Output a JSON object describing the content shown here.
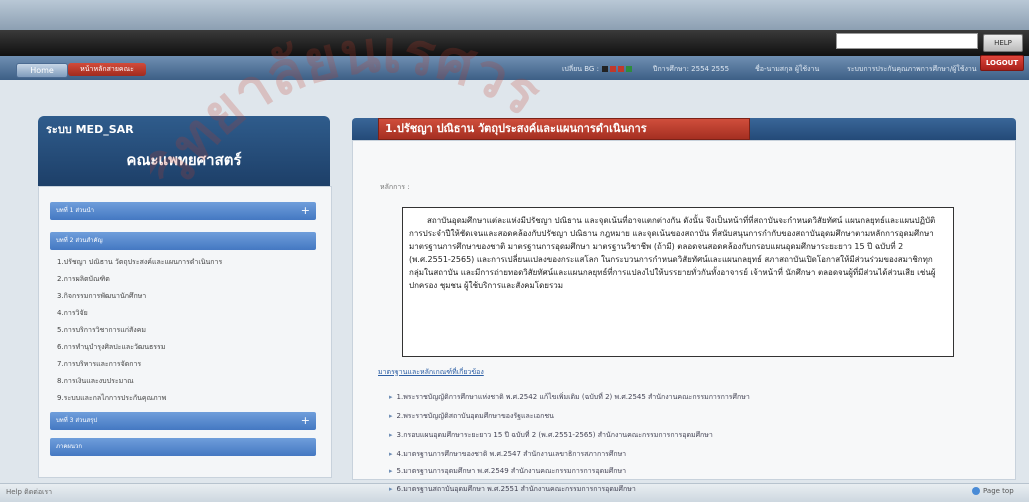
{
  "header": {
    "help_label": "HELP",
    "logout_label": "LOGOUT"
  },
  "nav": {
    "home": "Home",
    "crumb": "หน้าหลักสายคณะ",
    "bg_label": "เปลี่ยน BG :",
    "bg_colors": [
      "#222222",
      "#c0392b",
      "#c0392b",
      "#2e8b3e"
    ],
    "year_text": "ปีการศึกษา: 2554 2555",
    "user_text": "ชื่อ-นามสกุล ผู้ใช้งาน",
    "role_text": "ระบบการประกันคุณภาพการศึกษา/ผู้ใช้งาน"
  },
  "left": {
    "system_title": "ระบบ MED_SAR",
    "faculty": "คณะแพทยศาสตร์",
    "acc1": "บทที่ 1 ส่วนนำ",
    "acc2": "บทที่ 2 ส่วนสำคัญ",
    "items": [
      "1.ปรัชญา ปณิธาน วัตถุประสงค์และแผนการดำเนินการ",
      "2.การผลิตบัณฑิต",
      "3.กิจกรรมการพัฒนานักศึกษา",
      "4.การวิจัย",
      "5.การบริการวิชาการแก่สังคม",
      "6.การทำนุบำรุงศิลปะและวัฒนธรรม",
      "7.การบริหารและการจัดการ",
      "8.การเงินและงบประมาณ",
      "9.ระบบและกลไกการประกันคุณภาพ"
    ],
    "acc3": "บทที่ 3 ส่วนสรุป",
    "acc4": "ภาคผนวก"
  },
  "right": {
    "tab_title": "1.ปรัชญา ปณิธาน วัตถุประสงค์และแผนการดำเนินการ",
    "section_label": "หลักการ :",
    "vision_text": "สถาบันอุดมศึกษาแต่ละแห่งมีปรัชญา ปณิธาน และจุดเน้นที่อาจแตกต่างกัน ดังนั้น จึงเป็นหน้าที่ที่สถาบันจะกำหนดวิสัยทัศน์ แผนกลยุทธ์และแผนปฏิบัติการประจำปีให้ชัดเจนและสอดคล้องกับปรัชญา ปณิธาน กฎหมาย และจุดเน้นของสถาบัน ที่สนับสนุนการกำกับของสถาบันอุดมศึกษาตามหลักการอุดมศึกษา มาตรฐานการศึกษาของชาติ มาตรฐานการอุดมศึกษา มาตรฐานวิชาชีพ (ถ้ามี) ตลอดจนสอดคล้องกับกรอบแผนอุดมศึกษาระยะยาว 15 ปี ฉบับที่ 2 (พ.ศ.2551-2565) และการเปลี่ยนแปลงของกระแสโลก ในกระบวนการกำหนดวิสัยทัศน์และแผนกลยุทธ์ สภาสถาบันเปิดโอกาสให้มีส่วนร่วมของสมาชิกทุกกลุ่มในสถาบัน และมีการถ่ายทอดวิสัยทัศน์และแผนกลยุทธ์ที่การแปลงไปให้บรรยายทั่วกันทั้งอาจารย์ เจ้าหน้าที่ นักศึกษา ตลอดจนผู้ที่มีส่วนได้ส่วนเสีย เช่นผู้ปกครอง ชุมชน ผู้ใช้บริการและสังคมโดยรวม",
    "ref_head": "มาตรฐานและหลักเกณฑ์ที่เกี่ยวข้อง",
    "refs": [
      "1.พระราชบัญญัติการศึกษาแห่งชาติ พ.ศ.2542 แก้ไขเพิ่มเติม (ฉบับที่ 2) พ.ศ.2545 สำนักงานคณะกรรมการการศึกษา",
      "2.พระราชบัญญัติสถาบันอุดมศึกษาของรัฐและเอกชน",
      "3.กรอบแผนอุดมศึกษาระยะยาว 15 ปี ฉบับที่ 2 (พ.ศ.2551-2565) สำนักงานคณะกรรมการการอุดมศึกษา",
      "4.มาตรฐานการศึกษาของชาติ พ.ศ.2547 สำนักงานเลขาธิการสภาการศึกษา",
      "5.มาตรฐานการอุดมศึกษา พ.ศ.2549 สำนักงานคณะกรรมการการอุดมศึกษา",
      "6.มาตรฐานสถาบันอุดมศึกษา พ.ศ.2551 สำนักงานคณะกรรมการการอุดมศึกษา"
    ]
  },
  "footer": {
    "left": "Help  ติดต่อเรา",
    "right": "Page top"
  },
  "watermark": {
    "text": "วิทยาลัยนเรศวร",
    "color": "#c0392b"
  }
}
